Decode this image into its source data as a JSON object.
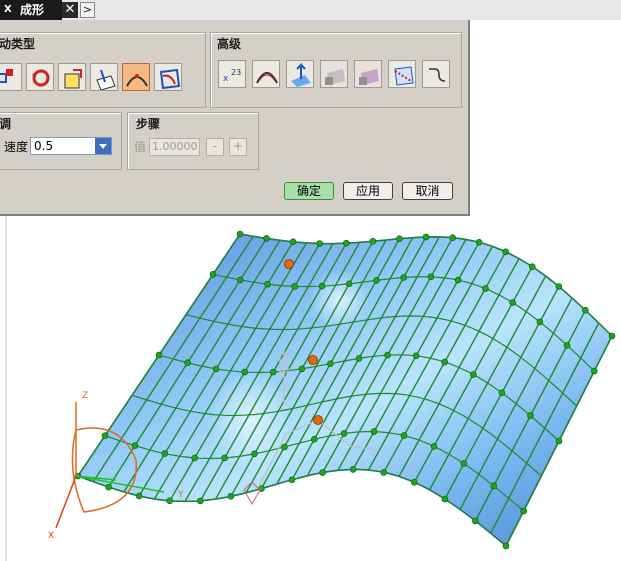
{
  "titlebar": {
    "title": "成形",
    "tab_icon_label": "X",
    "close_label": "✕",
    "expand_label": ">"
  },
  "dialog": {
    "motion_type_label": "动类型",
    "advanced_label": "高级",
    "adjust_label": "调",
    "speed_label": "速度",
    "speed_value": "0.5",
    "step_label": "步骤",
    "value_label": "值",
    "value_field": "1.00000",
    "minus_label": "-",
    "plus_label": "+",
    "ok_label": "确定",
    "apply_label": "应用",
    "cancel_label": "取消"
  },
  "toolbar_motion": [
    {
      "icon": "translate-icon"
    },
    {
      "icon": "rotate-icon"
    },
    {
      "icon": "scale-icon"
    },
    {
      "icon": "plane-normal-icon"
    },
    {
      "icon": "surface-shape-icon",
      "active": true
    },
    {
      "icon": "surface-edit-icon"
    }
  ],
  "toolbar_advanced": [
    {
      "icon": "degree-icon"
    },
    {
      "icon": "control-poles-icon"
    },
    {
      "icon": "surface-normal-icon"
    },
    {
      "icon": "locked-surface-icon",
      "disabled": true
    },
    {
      "icon": "locked-surface-2-icon",
      "disabled": true
    },
    {
      "icon": "curve-on-surface-icon"
    },
    {
      "icon": "s-curve-icon"
    }
  ],
  "axes": {
    "x": "X",
    "y": "Y",
    "z": "Z"
  },
  "colors": {
    "surface": "#6ea8e8",
    "isolines": "#1e8a2e",
    "poles": "#1aa81a",
    "handle": "#e86a10",
    "axis_x": "#e0401a",
    "axis_y": "#20c020",
    "axis_z": "#e06820"
  }
}
